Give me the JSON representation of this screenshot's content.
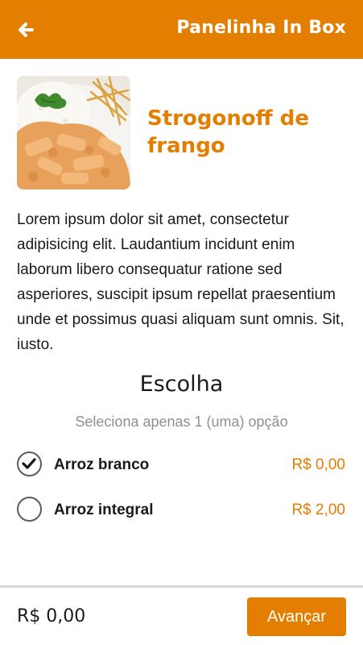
{
  "appbar": {
    "title": "Panelinha In Box",
    "back_icon": "arrow-left-icon"
  },
  "product": {
    "image_alt": "Prato de strogonoff de frango com arroz branco e batata palha",
    "name": "Strogonoff de frango",
    "description": "Lorem ipsum dolor sit amet, consectetur adipisicing elit. Laudantium incidunt enim laborum libero consequatur ratione sed asperiores, suscipit ipsum repellat praesentium unde et possimus quasi aliquam sunt omnis. Sit, iusto."
  },
  "choice": {
    "title": "Escolha",
    "subtitle": "Seleciona apenas 1 (uma) opção",
    "options": [
      {
        "label": "Arroz branco",
        "price": "R$ 0,00",
        "selected": true
      },
      {
        "label": "Arroz integral",
        "price": "R$ 2,00",
        "selected": false
      }
    ]
  },
  "footer": {
    "total": "R$ 0,00",
    "next_label": "Avançar"
  },
  "colors": {
    "accent": "#e37e00",
    "text": "#1a1a1a",
    "muted": "#8f8f8f"
  }
}
